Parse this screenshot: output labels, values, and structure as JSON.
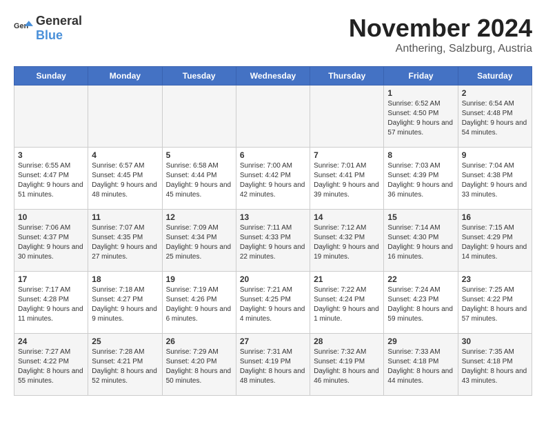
{
  "logo": {
    "general": "General",
    "blue": "Blue"
  },
  "title": "November 2024",
  "subtitle": "Anthering, Salzburg, Austria",
  "days_of_week": [
    "Sunday",
    "Monday",
    "Tuesday",
    "Wednesday",
    "Thursday",
    "Friday",
    "Saturday"
  ],
  "weeks": [
    [
      {
        "day": "",
        "info": ""
      },
      {
        "day": "",
        "info": ""
      },
      {
        "day": "",
        "info": ""
      },
      {
        "day": "",
        "info": ""
      },
      {
        "day": "",
        "info": ""
      },
      {
        "day": "1",
        "info": "Sunrise: 6:52 AM\nSunset: 4:50 PM\nDaylight: 9 hours and 57 minutes."
      },
      {
        "day": "2",
        "info": "Sunrise: 6:54 AM\nSunset: 4:48 PM\nDaylight: 9 hours and 54 minutes."
      }
    ],
    [
      {
        "day": "3",
        "info": "Sunrise: 6:55 AM\nSunset: 4:47 PM\nDaylight: 9 hours and 51 minutes."
      },
      {
        "day": "4",
        "info": "Sunrise: 6:57 AM\nSunset: 4:45 PM\nDaylight: 9 hours and 48 minutes."
      },
      {
        "day": "5",
        "info": "Sunrise: 6:58 AM\nSunset: 4:44 PM\nDaylight: 9 hours and 45 minutes."
      },
      {
        "day": "6",
        "info": "Sunrise: 7:00 AM\nSunset: 4:42 PM\nDaylight: 9 hours and 42 minutes."
      },
      {
        "day": "7",
        "info": "Sunrise: 7:01 AM\nSunset: 4:41 PM\nDaylight: 9 hours and 39 minutes."
      },
      {
        "day": "8",
        "info": "Sunrise: 7:03 AM\nSunset: 4:39 PM\nDaylight: 9 hours and 36 minutes."
      },
      {
        "day": "9",
        "info": "Sunrise: 7:04 AM\nSunset: 4:38 PM\nDaylight: 9 hours and 33 minutes."
      }
    ],
    [
      {
        "day": "10",
        "info": "Sunrise: 7:06 AM\nSunset: 4:37 PM\nDaylight: 9 hours and 30 minutes."
      },
      {
        "day": "11",
        "info": "Sunrise: 7:07 AM\nSunset: 4:35 PM\nDaylight: 9 hours and 27 minutes."
      },
      {
        "day": "12",
        "info": "Sunrise: 7:09 AM\nSunset: 4:34 PM\nDaylight: 9 hours and 25 minutes."
      },
      {
        "day": "13",
        "info": "Sunrise: 7:11 AM\nSunset: 4:33 PM\nDaylight: 9 hours and 22 minutes."
      },
      {
        "day": "14",
        "info": "Sunrise: 7:12 AM\nSunset: 4:32 PM\nDaylight: 9 hours and 19 minutes."
      },
      {
        "day": "15",
        "info": "Sunrise: 7:14 AM\nSunset: 4:30 PM\nDaylight: 9 hours and 16 minutes."
      },
      {
        "day": "16",
        "info": "Sunrise: 7:15 AM\nSunset: 4:29 PM\nDaylight: 9 hours and 14 minutes."
      }
    ],
    [
      {
        "day": "17",
        "info": "Sunrise: 7:17 AM\nSunset: 4:28 PM\nDaylight: 9 hours and 11 minutes."
      },
      {
        "day": "18",
        "info": "Sunrise: 7:18 AM\nSunset: 4:27 PM\nDaylight: 9 hours and 9 minutes."
      },
      {
        "day": "19",
        "info": "Sunrise: 7:19 AM\nSunset: 4:26 PM\nDaylight: 9 hours and 6 minutes."
      },
      {
        "day": "20",
        "info": "Sunrise: 7:21 AM\nSunset: 4:25 PM\nDaylight: 9 hours and 4 minutes."
      },
      {
        "day": "21",
        "info": "Sunrise: 7:22 AM\nSunset: 4:24 PM\nDaylight: 9 hours and 1 minute."
      },
      {
        "day": "22",
        "info": "Sunrise: 7:24 AM\nSunset: 4:23 PM\nDaylight: 8 hours and 59 minutes."
      },
      {
        "day": "23",
        "info": "Sunrise: 7:25 AM\nSunset: 4:22 PM\nDaylight: 8 hours and 57 minutes."
      }
    ],
    [
      {
        "day": "24",
        "info": "Sunrise: 7:27 AM\nSunset: 4:22 PM\nDaylight: 8 hours and 55 minutes."
      },
      {
        "day": "25",
        "info": "Sunrise: 7:28 AM\nSunset: 4:21 PM\nDaylight: 8 hours and 52 minutes."
      },
      {
        "day": "26",
        "info": "Sunrise: 7:29 AM\nSunset: 4:20 PM\nDaylight: 8 hours and 50 minutes."
      },
      {
        "day": "27",
        "info": "Sunrise: 7:31 AM\nSunset: 4:19 PM\nDaylight: 8 hours and 48 minutes."
      },
      {
        "day": "28",
        "info": "Sunrise: 7:32 AM\nSunset: 4:19 PM\nDaylight: 8 hours and 46 minutes."
      },
      {
        "day": "29",
        "info": "Sunrise: 7:33 AM\nSunset: 4:18 PM\nDaylight: 8 hours and 44 minutes."
      },
      {
        "day": "30",
        "info": "Sunrise: 7:35 AM\nSunset: 4:18 PM\nDaylight: 8 hours and 43 minutes."
      }
    ]
  ]
}
